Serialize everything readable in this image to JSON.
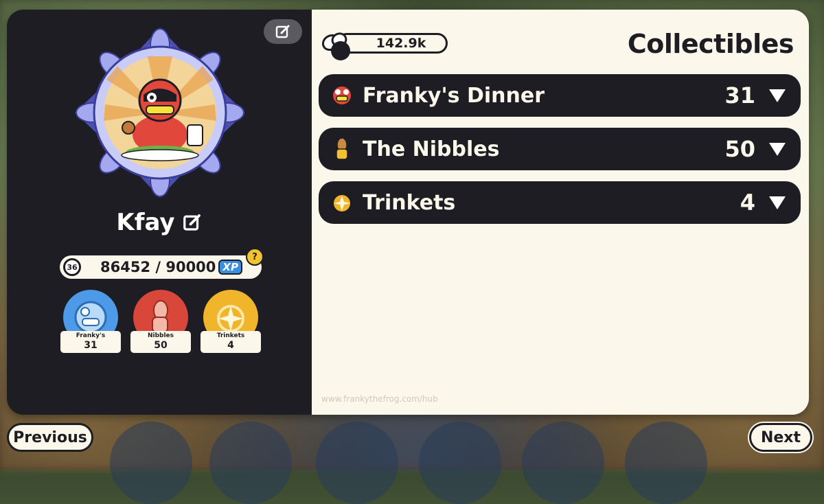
{
  "profile": {
    "username": "Kfay",
    "level": "36",
    "xp_text": "86452 / 90000",
    "xp_tag": "XP",
    "help": "?"
  },
  "stats": [
    {
      "name": "Franky's",
      "count": "31",
      "color": "#4d9be8",
      "icon": "frog-face-icon"
    },
    {
      "name": "Nibbles",
      "count": "50",
      "color": "#d8473a",
      "icon": "thumbs-up-icon"
    },
    {
      "name": "Trinkets",
      "count": "4",
      "color": "#f0b52a",
      "icon": "sparkle-icon"
    }
  ],
  "currency": {
    "amount": "142.9k",
    "icon": "fly-coin-icon"
  },
  "collectibles": {
    "title": "Collectibles",
    "categories": [
      {
        "name": "Franky's Dinner",
        "count": "31",
        "icon": "frog-face-icon"
      },
      {
        "name": "The Nibbles",
        "count": "50",
        "icon": "thumbs-up-icon"
      },
      {
        "name": "Trinkets",
        "count": "4",
        "icon": "sparkle-icon"
      }
    ]
  },
  "footer": {
    "url": "www.frankythefrog.com/hub"
  },
  "nav": {
    "previous": "Previous",
    "next": "Next"
  },
  "colors": {
    "panel_dark": "#1d1d23",
    "panel_light": "#fbf7ea",
    "medal_purple": "#7b7fd6"
  }
}
